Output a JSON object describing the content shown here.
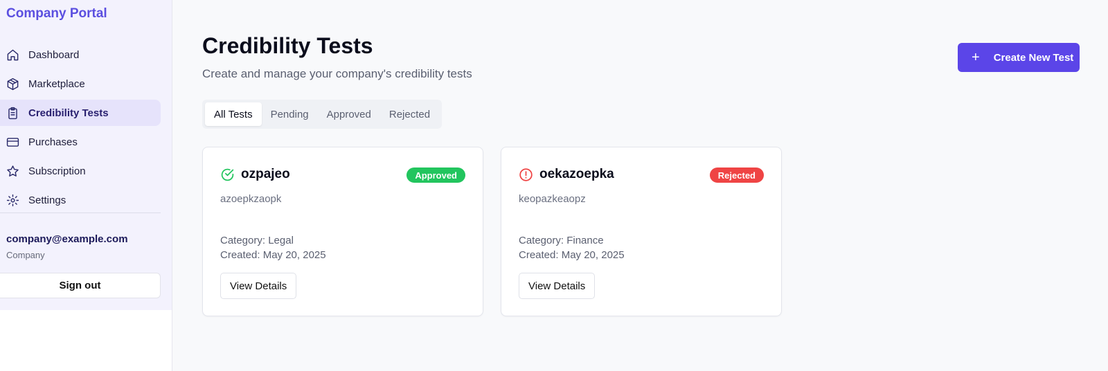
{
  "brand": "Company Portal",
  "nav": [
    {
      "label": "Dashboard",
      "icon": "home-icon",
      "active": false
    },
    {
      "label": "Marketplace",
      "icon": "package-icon",
      "active": false
    },
    {
      "label": "Credibility Tests",
      "icon": "clipboard-icon",
      "active": true
    },
    {
      "label": "Purchases",
      "icon": "credit-card-icon",
      "active": false
    },
    {
      "label": "Subscription",
      "icon": "star-icon",
      "active": false
    },
    {
      "label": "Settings",
      "icon": "gear-icon",
      "active": false
    }
  ],
  "user": {
    "email": "company@example.com",
    "role": "Company"
  },
  "signout_label": "Sign out",
  "page": {
    "title": "Credibility Tests",
    "subtitle": "Create and manage your company's credibility tests",
    "create_label": "Create New Test",
    "create_icon": "plus-icon"
  },
  "tabs": [
    {
      "label": "All Tests",
      "active": true
    },
    {
      "label": "Pending",
      "active": false
    },
    {
      "label": "Approved",
      "active": false
    },
    {
      "label": "Rejected",
      "active": false
    }
  ],
  "cards": [
    {
      "title": "ozpajeo",
      "status": "Approved",
      "status_icon": "check-circle-icon",
      "status_color": "#22c55e",
      "description": "azoepkzaopk",
      "category": "Category: Legal",
      "created": "Created: May 20, 2025",
      "button": "View Details"
    },
    {
      "title": "oekazoepka",
      "status": "Rejected",
      "status_icon": "alert-circle-icon",
      "status_color": "#ef4444",
      "description": "keopazkeaopz",
      "category": "Category: Finance",
      "created": "Created: May 20, 2025",
      "button": "View Details"
    }
  ],
  "colors": {
    "accent": "#5b45e8",
    "sidebar_bg": "#f3f2fd",
    "approved": "#22c55e",
    "rejected": "#ef4444"
  }
}
